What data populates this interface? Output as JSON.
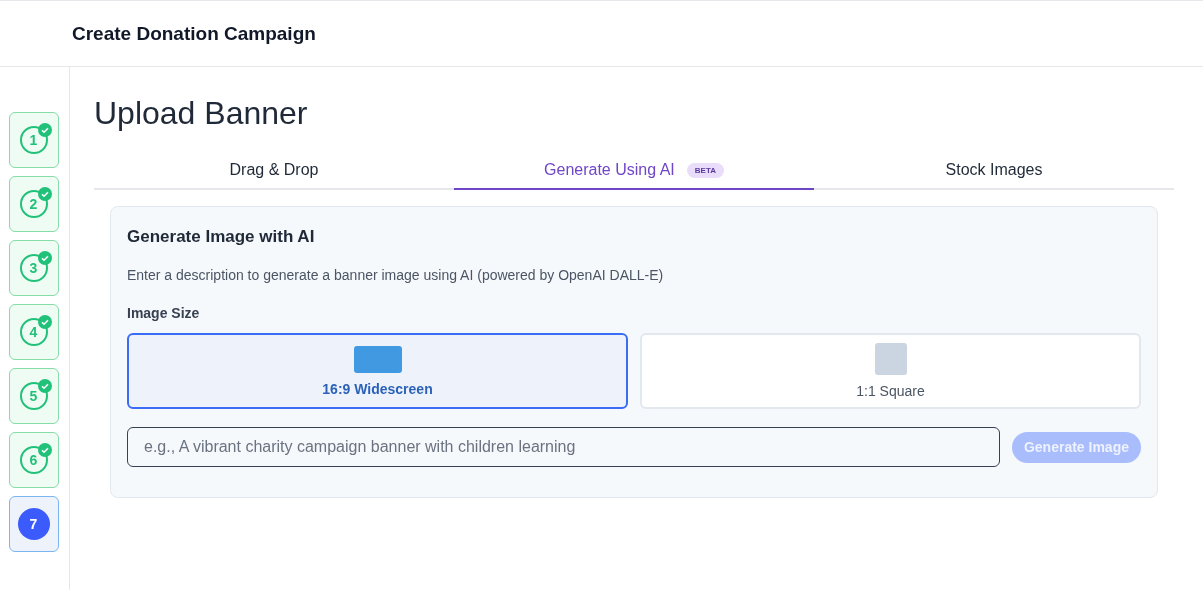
{
  "header": {
    "title": "Create Donation Campaign"
  },
  "steps": [
    {
      "number": "1",
      "done": true,
      "selected": false
    },
    {
      "number": "2",
      "done": true,
      "selected": false
    },
    {
      "number": "3",
      "done": true,
      "selected": false
    },
    {
      "number": "4",
      "done": true,
      "selected": false
    },
    {
      "number": "5",
      "done": true,
      "selected": false
    },
    {
      "number": "6",
      "done": true,
      "selected": false
    },
    {
      "number": "7",
      "done": false,
      "selected": true
    }
  ],
  "page_title": "Upload Banner",
  "tabs": [
    {
      "label": "Drag & Drop",
      "selected": false
    },
    {
      "label": "Generate Using AI",
      "badge": "BETA",
      "selected": true
    },
    {
      "label": "Stock Images",
      "selected": false
    }
  ],
  "panel": {
    "title": "Generate Image with AI",
    "description": "Enter a description to generate a banner image using AI (powered by OpenAI DALL-E)",
    "size_label": "Image Size",
    "sizes": [
      {
        "kind": "widescreen",
        "label": "16:9 Widescreen",
        "selected": true
      },
      {
        "kind": "square",
        "label": "1:1 Square",
        "selected": false
      }
    ],
    "prompt": {
      "placeholder": "e.g., A vibrant charity campaign banner with children learning"
    },
    "generate_button": {
      "label": "Generate Image",
      "disabled": true
    }
  }
}
